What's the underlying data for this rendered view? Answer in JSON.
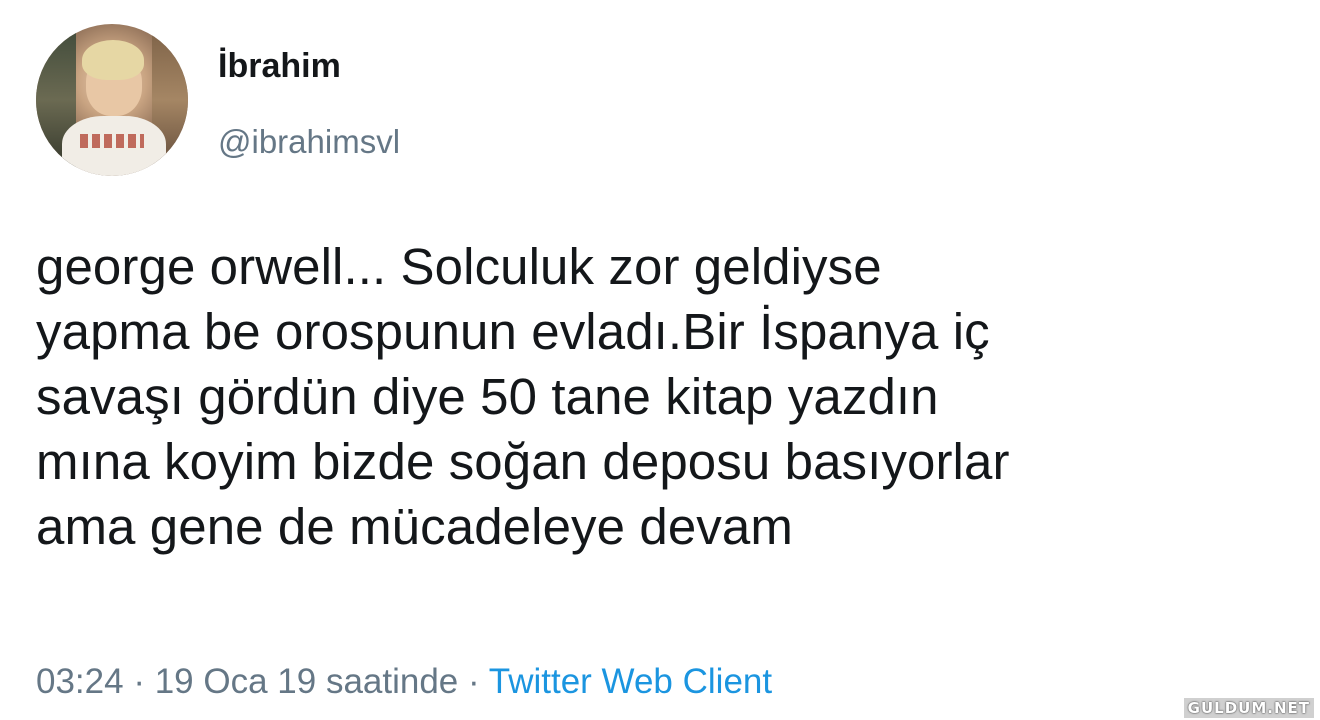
{
  "user": {
    "display_name": "İbrahim",
    "handle": "@ibrahimsvl"
  },
  "tweet": {
    "text_lines": [
      "george orwell... Solculuk zor geldiyse",
      "yapma be orospunun evladı.Bir İspanya iç",
      "savaşı gördün diye 50 tane kitap yazdın",
      "mına koyim bizde soğan deposu basıyorlar",
      "ama gene de mücadeleye devam"
    ],
    "time": "03:24",
    "date": "19 Oca 19 saatinde",
    "separator": "·",
    "source": "Twitter Web Client"
  },
  "watermark": "GULDUM.NET",
  "colors": {
    "text": "#14171a",
    "secondary": "#657786",
    "link": "#1b95e0"
  }
}
